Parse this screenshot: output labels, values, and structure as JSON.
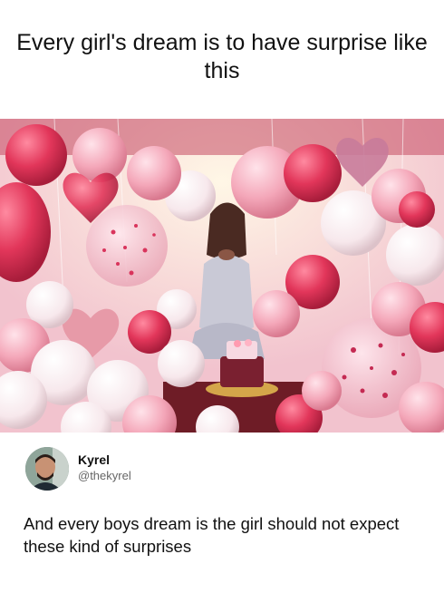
{
  "caption": "Every girl's dream is to have surprise like this",
  "photo": {
    "subject": "woman-surrounded-by-balloons",
    "colors": [
      "#e8476a",
      "#f6c0cc",
      "#ffffff",
      "#c9304e"
    ]
  },
  "tweet": {
    "author_name": "Kyrel",
    "author_handle": "@thekyrel",
    "text": "And every boys dream is the girl should not expect these kind of surprises"
  }
}
